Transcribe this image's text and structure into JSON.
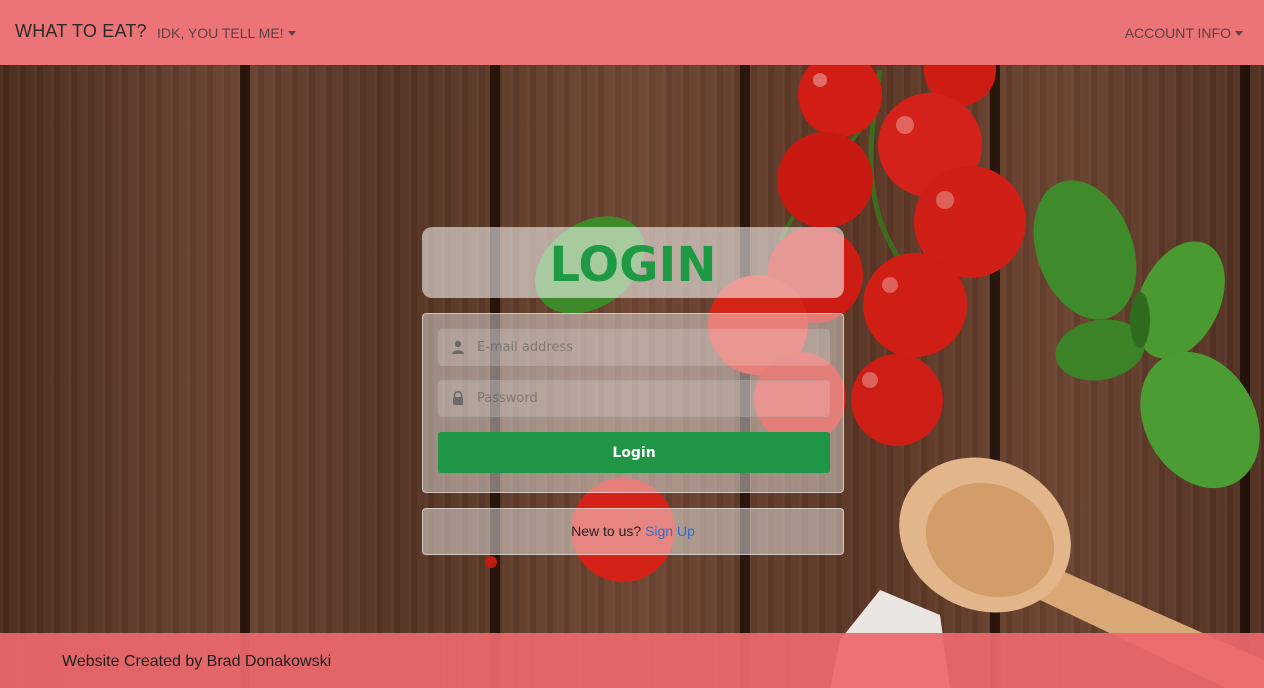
{
  "navbar": {
    "brand": "WHAT TO EAT?",
    "left_dropdown": "IDK, YOU TELL ME!",
    "right_dropdown": "ACCOUNT INFO"
  },
  "login": {
    "title": "LOGIN",
    "email_placeholder": "E-mail address",
    "password_placeholder": "Password",
    "submit_label": "Login"
  },
  "signup": {
    "prompt": "New to us?",
    "link_label": "Sign Up"
  },
  "footer": {
    "text": "Website Created by Brad Donakowski"
  },
  "colors": {
    "navbar": "#ec7477",
    "footer": "#ec686d",
    "accent_green": "#1e9645",
    "link_blue": "#2c6fd6"
  },
  "icons": {
    "email_field": "user-icon",
    "password_field": "lock-icon",
    "nav_dropdowns": "caret-down-icon"
  }
}
